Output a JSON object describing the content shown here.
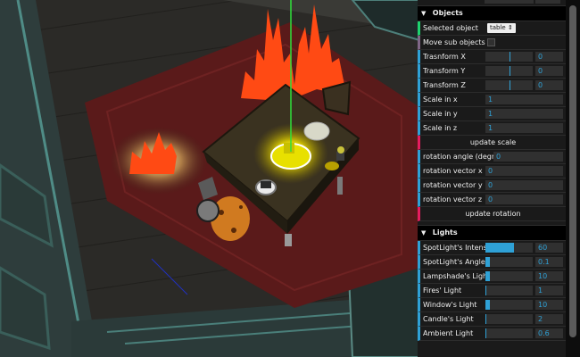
{
  "objects_folder": {
    "title": "Objects",
    "selected_object_label": "Selected object",
    "selected_object_value": "table",
    "move_sub_objects_label": "Move sub objects",
    "transform_x_label": "Trasnform X",
    "transform_x_value": "0",
    "transform_x_level": 0.5,
    "transform_y_label": "Transform Y",
    "transform_y_value": "0",
    "transform_y_level": 0.5,
    "transform_z_label": "Transform Z",
    "transform_z_value": "0",
    "transform_z_level": 0.5,
    "scale_x_label": "Scale in x",
    "scale_x_value": "1",
    "scale_y_label": "Scale in y",
    "scale_y_value": "1",
    "scale_z_label": "Scale in z",
    "scale_z_value": "1",
    "update_scale_label": "update scale",
    "rotation_angle_label": "rotation angle (degrees)",
    "rotation_angle_value": "0",
    "rotation_vector_x_label": "rotation vector x",
    "rotation_vector_x_value": "0",
    "rotation_vector_y_label": "rotation vector y",
    "rotation_vector_y_value": "0",
    "rotation_vector_z_label": "rotation vector z",
    "rotation_vector_z_value": "0",
    "update_rotation_label": "update rotation"
  },
  "lights_folder": {
    "title": "Lights",
    "items": [
      {
        "label": "SpotLight's Intensity",
        "value": "60",
        "level": 0.6
      },
      {
        "label": "SpotLight's Angle",
        "value": "0.1",
        "level": 0.1
      },
      {
        "label": "Lampshade's Light",
        "value": "10",
        "level": 0.1
      },
      {
        "label": "Fires' Light",
        "value": "1",
        "level": 0.02
      },
      {
        "label": "Window's Light",
        "value": "10",
        "level": 0.1
      },
      {
        "label": "Candle's Light",
        "value": "2",
        "level": 0.02
      },
      {
        "label": "Ambient Light",
        "value": "0.6",
        "level": 0.02
      }
    ]
  },
  "colors": {
    "accent_number": "#2fa1d6",
    "accent_function": "#e61d5f",
    "accent_boolean": "#806787",
    "accent_select": "#1ed36f",
    "panel_bg": "#1a1a1a",
    "fire": "#ff4a14"
  },
  "icons": {
    "folder_open": "triangle-down-icon"
  }
}
